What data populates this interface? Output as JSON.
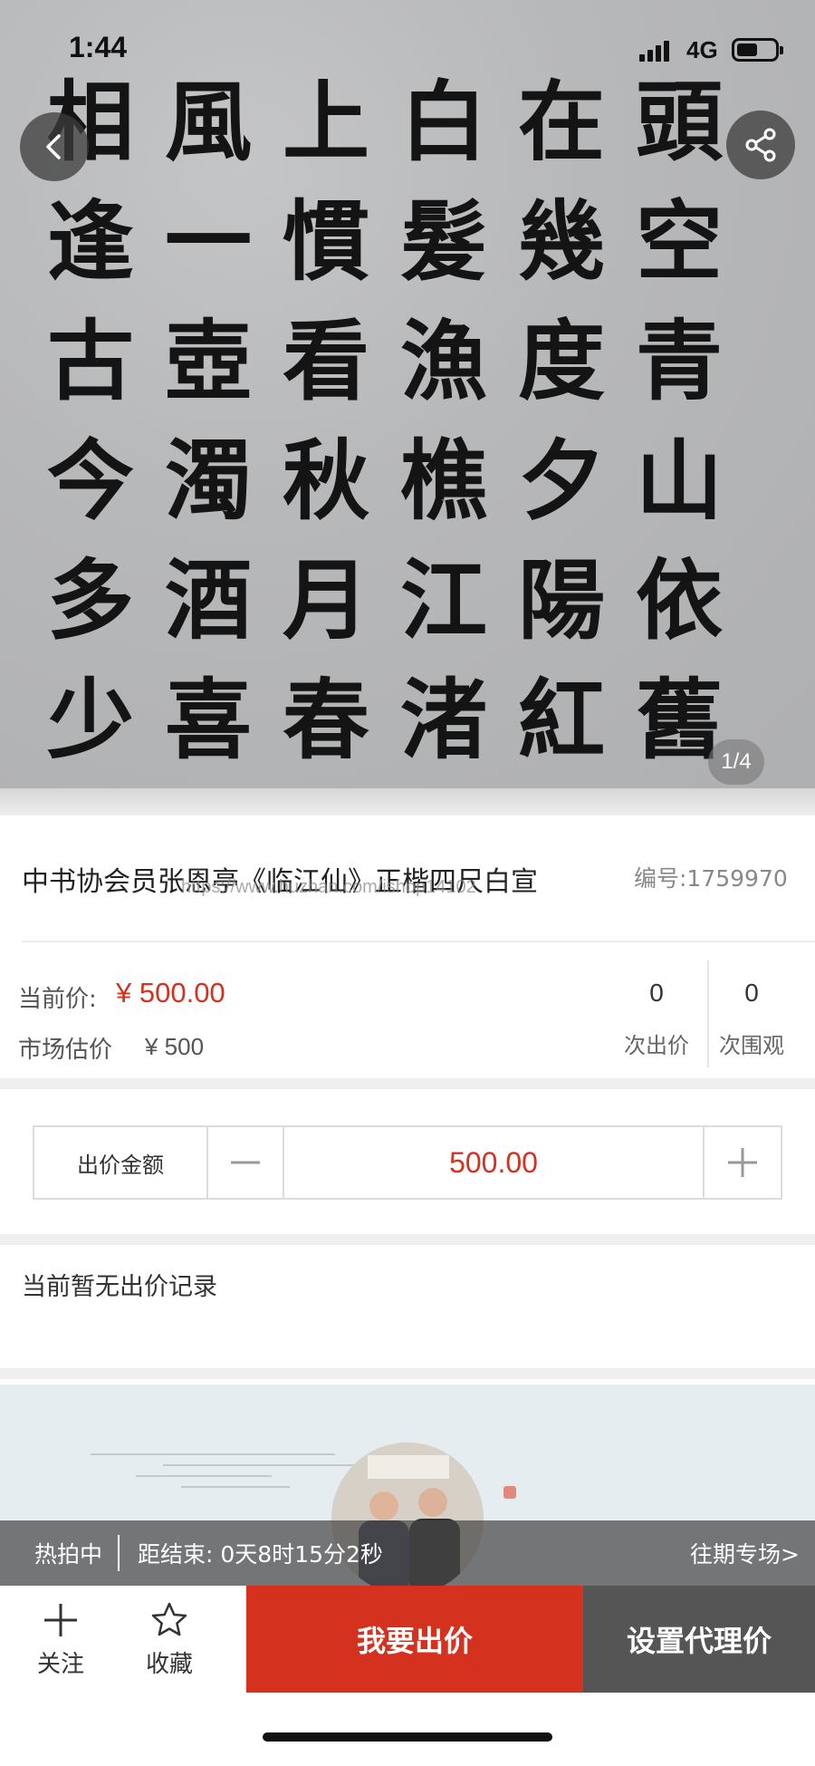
{
  "status_bar": {
    "time": "1:44",
    "network": "4G"
  },
  "gallery": {
    "counter": "1/4",
    "columns": [
      [
        "",
        "",
        "",
        "",
        "",
        ""
      ],
      [
        "頭",
        "空",
        "青",
        "山",
        "依",
        "舊"
      ],
      [
        "在",
        "幾",
        "度",
        "夕",
        "陽",
        "紅"
      ],
      [
        "白",
        "髮",
        "漁",
        "樵",
        "江",
        "渚"
      ],
      [
        "上",
        "慣",
        "看",
        "秋",
        "月",
        "春"
      ],
      [
        "風",
        "一",
        "壺",
        "濁",
        "酒",
        "喜"
      ],
      [
        "相",
        "逢",
        "古",
        "今",
        "多",
        "少"
      ]
    ]
  },
  "item": {
    "title": "中书协会员张恩亭《临江仙》正楷四尺白宣",
    "watermark": "https://www.huzhan.com/ishop14102",
    "lot_number": "编号:1759970"
  },
  "price": {
    "current_label": "当前价:",
    "current_value": "¥ 500.00",
    "market_label": "市场估价",
    "market_value": "¥ 500",
    "bids_count": "0",
    "bids_label": "次出价",
    "views_count": "0",
    "views_label": "次围观"
  },
  "bid": {
    "label": "出价金额",
    "value": "500.00"
  },
  "records": {
    "empty_text": "当前暂无出价记录"
  },
  "auction": {
    "status": "热拍中",
    "countdown": "距结束: 0天8时15分2秒",
    "past_link": "往期专场>"
  },
  "actions": {
    "follow_label": "关注",
    "favorite_label": "收藏",
    "bid_button": "我要出价",
    "proxy_button": "设置代理价"
  },
  "colors": {
    "accent_red": "#d4311f",
    "proxy_gray": "#555555"
  }
}
